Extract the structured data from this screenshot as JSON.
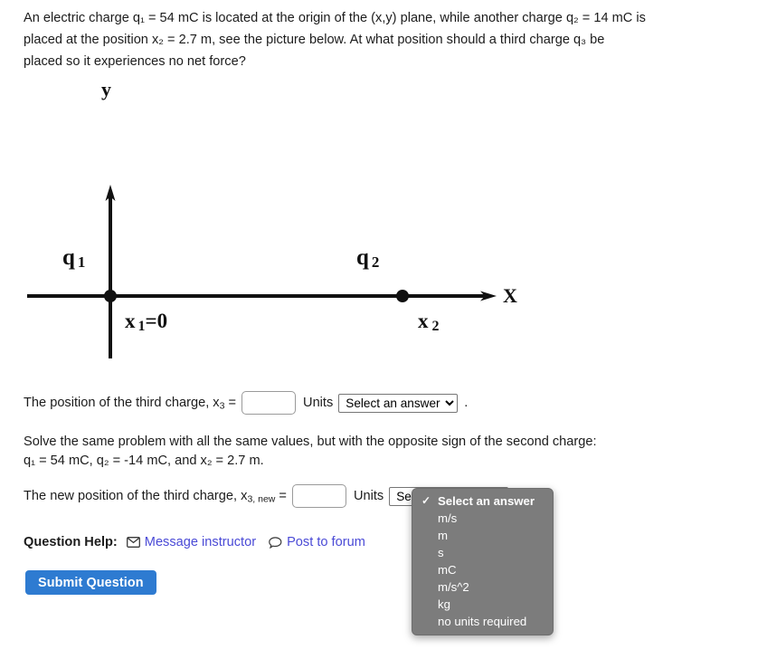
{
  "problem": {
    "lines": [
      "An electric charge q₁ = 54 mC is located at the origin of the (x,y) plane, while another charge q₂ = 14 mC is",
      "placed at the position x₂ = 2.7 m, see the picture below. At what position should a third charge q₃ be",
      "placed so it experiences no net force?"
    ],
    "charge1_label": "q1",
    "charge1_value": "54 mC",
    "charge2_label": "q2",
    "charge2_value": "14 mC",
    "charge3_label": "q3",
    "x2_value": "2.7 m"
  },
  "figure": {
    "y_axis_label": "y",
    "x_axis_label": "X",
    "charge1_label": "q",
    "charge1_sub": "1",
    "charge2_label": "q",
    "charge2_sub": "2",
    "x1_label": "x",
    "x1_sub": "1",
    "x1_equals": "=0",
    "x2_label": "x",
    "x2_sub": "2"
  },
  "answer_rows": [
    {
      "prompt_prefix": "The position of the third charge, x",
      "prompt_sub": "3",
      "prompt_suffix": " =",
      "input_value": "",
      "input_placeholder": "",
      "units_label": "Units",
      "select_value": "Select an answer",
      "trailing": "."
    },
    {
      "prompt_prefix": "The new position of the third charge, x",
      "prompt_sub": "3, new",
      "prompt_suffix": " =",
      "input_value": "",
      "input_placeholder": "",
      "units_label": "Units",
      "select_value": "Select an answer",
      "trailing": "."
    }
  ],
  "mid_paragraph": {
    "lines": [
      "Solve the same problem with all the same values, but with the opposite sign of the second charge:",
      "q₁ = 54 mC, q₂ = -14 mC, and x₂ = 2.7 m."
    ]
  },
  "unit_options": [
    "Select an answer",
    "m/s",
    "m",
    "s",
    "mC",
    "m/s^2",
    "kg",
    "no units required"
  ],
  "dropdown": {
    "selected_index": 0,
    "check_glyph": "✓"
  },
  "question_help": {
    "label": "Question Help:",
    "message_instructor": "Message instructor",
    "post_to_forum": "Post to forum"
  },
  "submit": {
    "label": "Submit Question"
  },
  "colors": {
    "link": "#4a4ad6",
    "submit_bg": "#2e7bd1",
    "dropdown_bg": "#7c7c7c",
    "text": "#1c1c1c"
  }
}
